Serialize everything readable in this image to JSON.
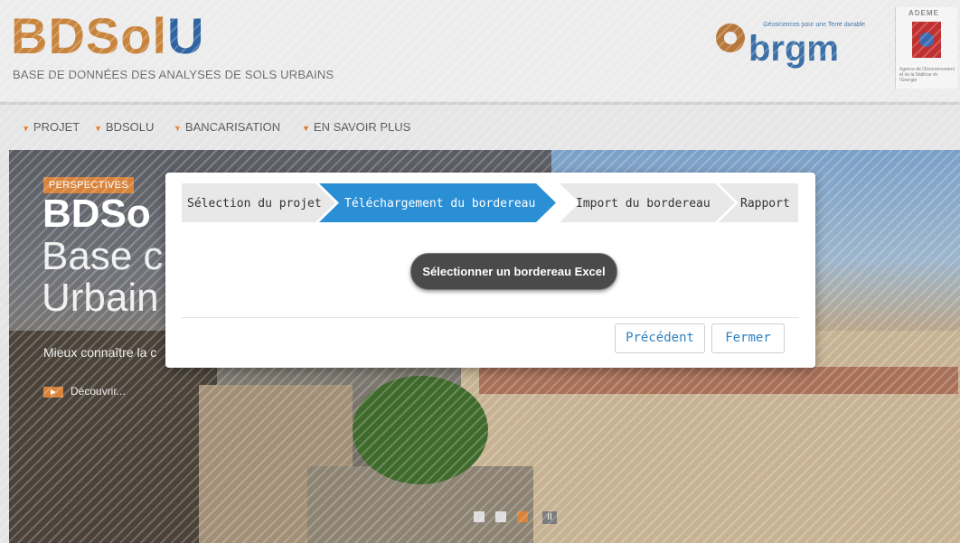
{
  "header": {
    "logo_part1": "BDSol",
    "logo_part2": "U",
    "subtitle": "BASE DE DONNÉES DES ANALYSES DE SOLS URBAINS",
    "brgm_text": "brgm",
    "brgm_tagline": "Géosciences pour une Terre durable",
    "ademe_title": "ADEME",
    "ademe_sub": "Agence de l'Environnement et de la Maîtrise de l'Énergie"
  },
  "nav": {
    "items": [
      {
        "label": "PROJET"
      },
      {
        "label": "BDSOLU"
      },
      {
        "label": "BANCARISATION"
      },
      {
        "label": "EN SAVOIR PLUS"
      }
    ]
  },
  "hero": {
    "badge": "PERSPECTIVES",
    "title": "BDSo",
    "line2": "Base c",
    "line3": "Urbain",
    "description": "Mieux connaître la c",
    "discover": "Découvrir...",
    "pause_glyph": "II"
  },
  "wizard": {
    "steps": [
      {
        "label": "Sélection du projet",
        "active": false
      },
      {
        "label": "Téléchargement du bordereau",
        "active": true
      },
      {
        "label": "Import du bordereau",
        "active": false
      },
      {
        "label": "Rapport",
        "active": false
      }
    ],
    "select_button": "Sélectionner un bordereau Excel",
    "prev_button": "Précédent",
    "close_button": "Fermer"
  },
  "colors": {
    "accent_orange": "#d9823a",
    "step_active": "#2b8fd6",
    "step_inactive": "#e8e8e8",
    "link_blue": "#2f80c0"
  }
}
